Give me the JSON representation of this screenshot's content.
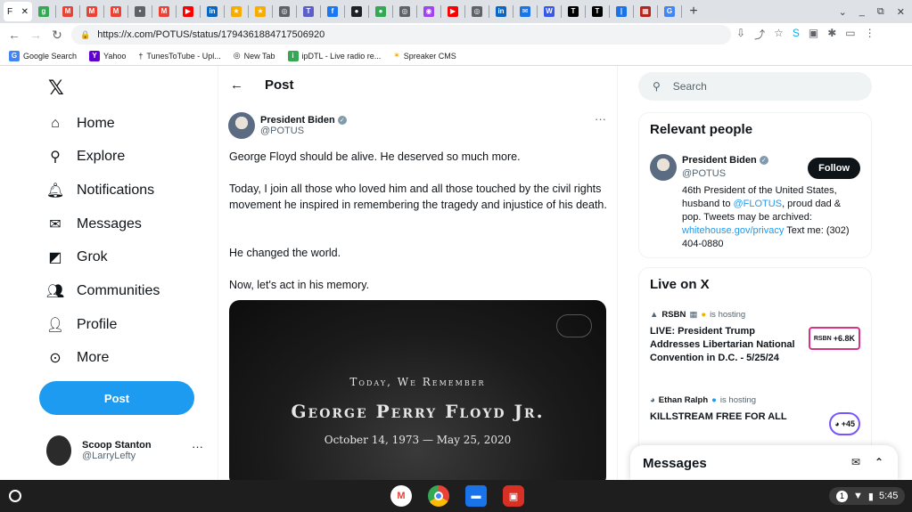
{
  "browser": {
    "active_tab_label": "F",
    "url": "https://x.com/POTUS/status/1794361884717506920",
    "bookmarks": [
      "Google Search",
      "Yahoo",
      "TunesToTube - Upl...",
      "New Tab",
      "ipDTL - Live radio re...",
      "Spreaker CMS"
    ]
  },
  "nav": {
    "items": [
      "Home",
      "Explore",
      "Notifications",
      "Messages",
      "Grok",
      "Communities",
      "Profile",
      "More"
    ],
    "post_label": "Post",
    "account_name": "Scoop Stanton",
    "account_handle": "@LarryLefty"
  },
  "header": {
    "title": "Post"
  },
  "post": {
    "author_name": "President Biden",
    "author_handle": "@POTUS",
    "paragraphs": [
      "George Floyd should be alive. He deserved so much more.",
      "Today, I join all those who loved him and all those touched by the civil rights movement he inspired in remembering the tragedy and injustice of his death.",
      "He changed the world.",
      "Now, let's act in his memory."
    ],
    "media_line1": "Today, We Remember",
    "media_line2": "George Perry Floyd Jr.",
    "media_line3": "October 14, 1973 — May 25, 2020"
  },
  "search": {
    "placeholder": "Search"
  },
  "relevant": {
    "title": "Relevant people",
    "name": "President Biden",
    "handle": "@POTUS",
    "follow_label": "Follow",
    "bio_1": "46th President of the United States, husband to ",
    "bio_link1": "@FLOTUS",
    "bio_2": ", proud dad & pop. Tweets may be archived: ",
    "bio_link2": "whitehouse.gov/privacy",
    "bio_3": " Text me: (302) 404-0880"
  },
  "live": {
    "title": "Live on X",
    "items": [
      {
        "host": "RSBN",
        "hosting": "is hosting",
        "title": "LIVE: President Trump Addresses Libertarian National Convention in D.C. - 5/25/24",
        "count": "+6.8K"
      },
      {
        "host": "Ethan Ralph",
        "hosting": "is hosting",
        "title": "KILLSTREAM FREE FOR ALL",
        "count": "+45"
      }
    ]
  },
  "messages": {
    "title": "Messages"
  },
  "shelf": {
    "notifications": "1",
    "time": "5:45"
  }
}
